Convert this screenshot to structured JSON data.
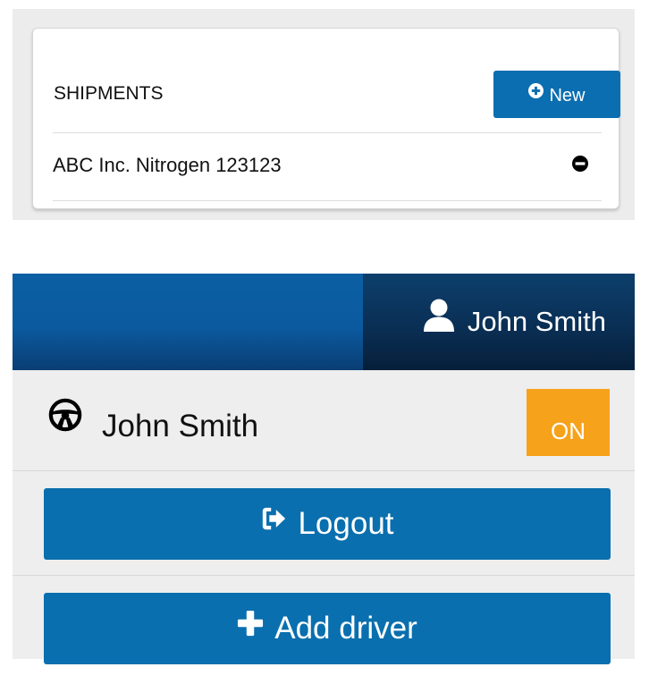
{
  "shipments": {
    "title": "SHIPMENTS",
    "new_button_label": "New",
    "new_button_icon": "plus-circle-icon",
    "items": [
      {
        "label": "ABC Inc. Nitrogen 123123",
        "action_icon": "minus-circle-icon"
      }
    ]
  },
  "header": {
    "user_name": "John Smith",
    "user_icon": "user-icon"
  },
  "driver": {
    "name": "John Smith",
    "icon": "steering-wheel-icon",
    "status": "ON",
    "logout_label": "Logout",
    "logout_icon": "sign-out-icon",
    "add_driver_label": "Add driver",
    "add_driver_icon": "plus-icon"
  },
  "colors": {
    "primary_blue": "#0b6eb0",
    "header_dark": "#0a2f55",
    "status_on": "#f7a21b",
    "panel_bg": "#eeeeee"
  }
}
